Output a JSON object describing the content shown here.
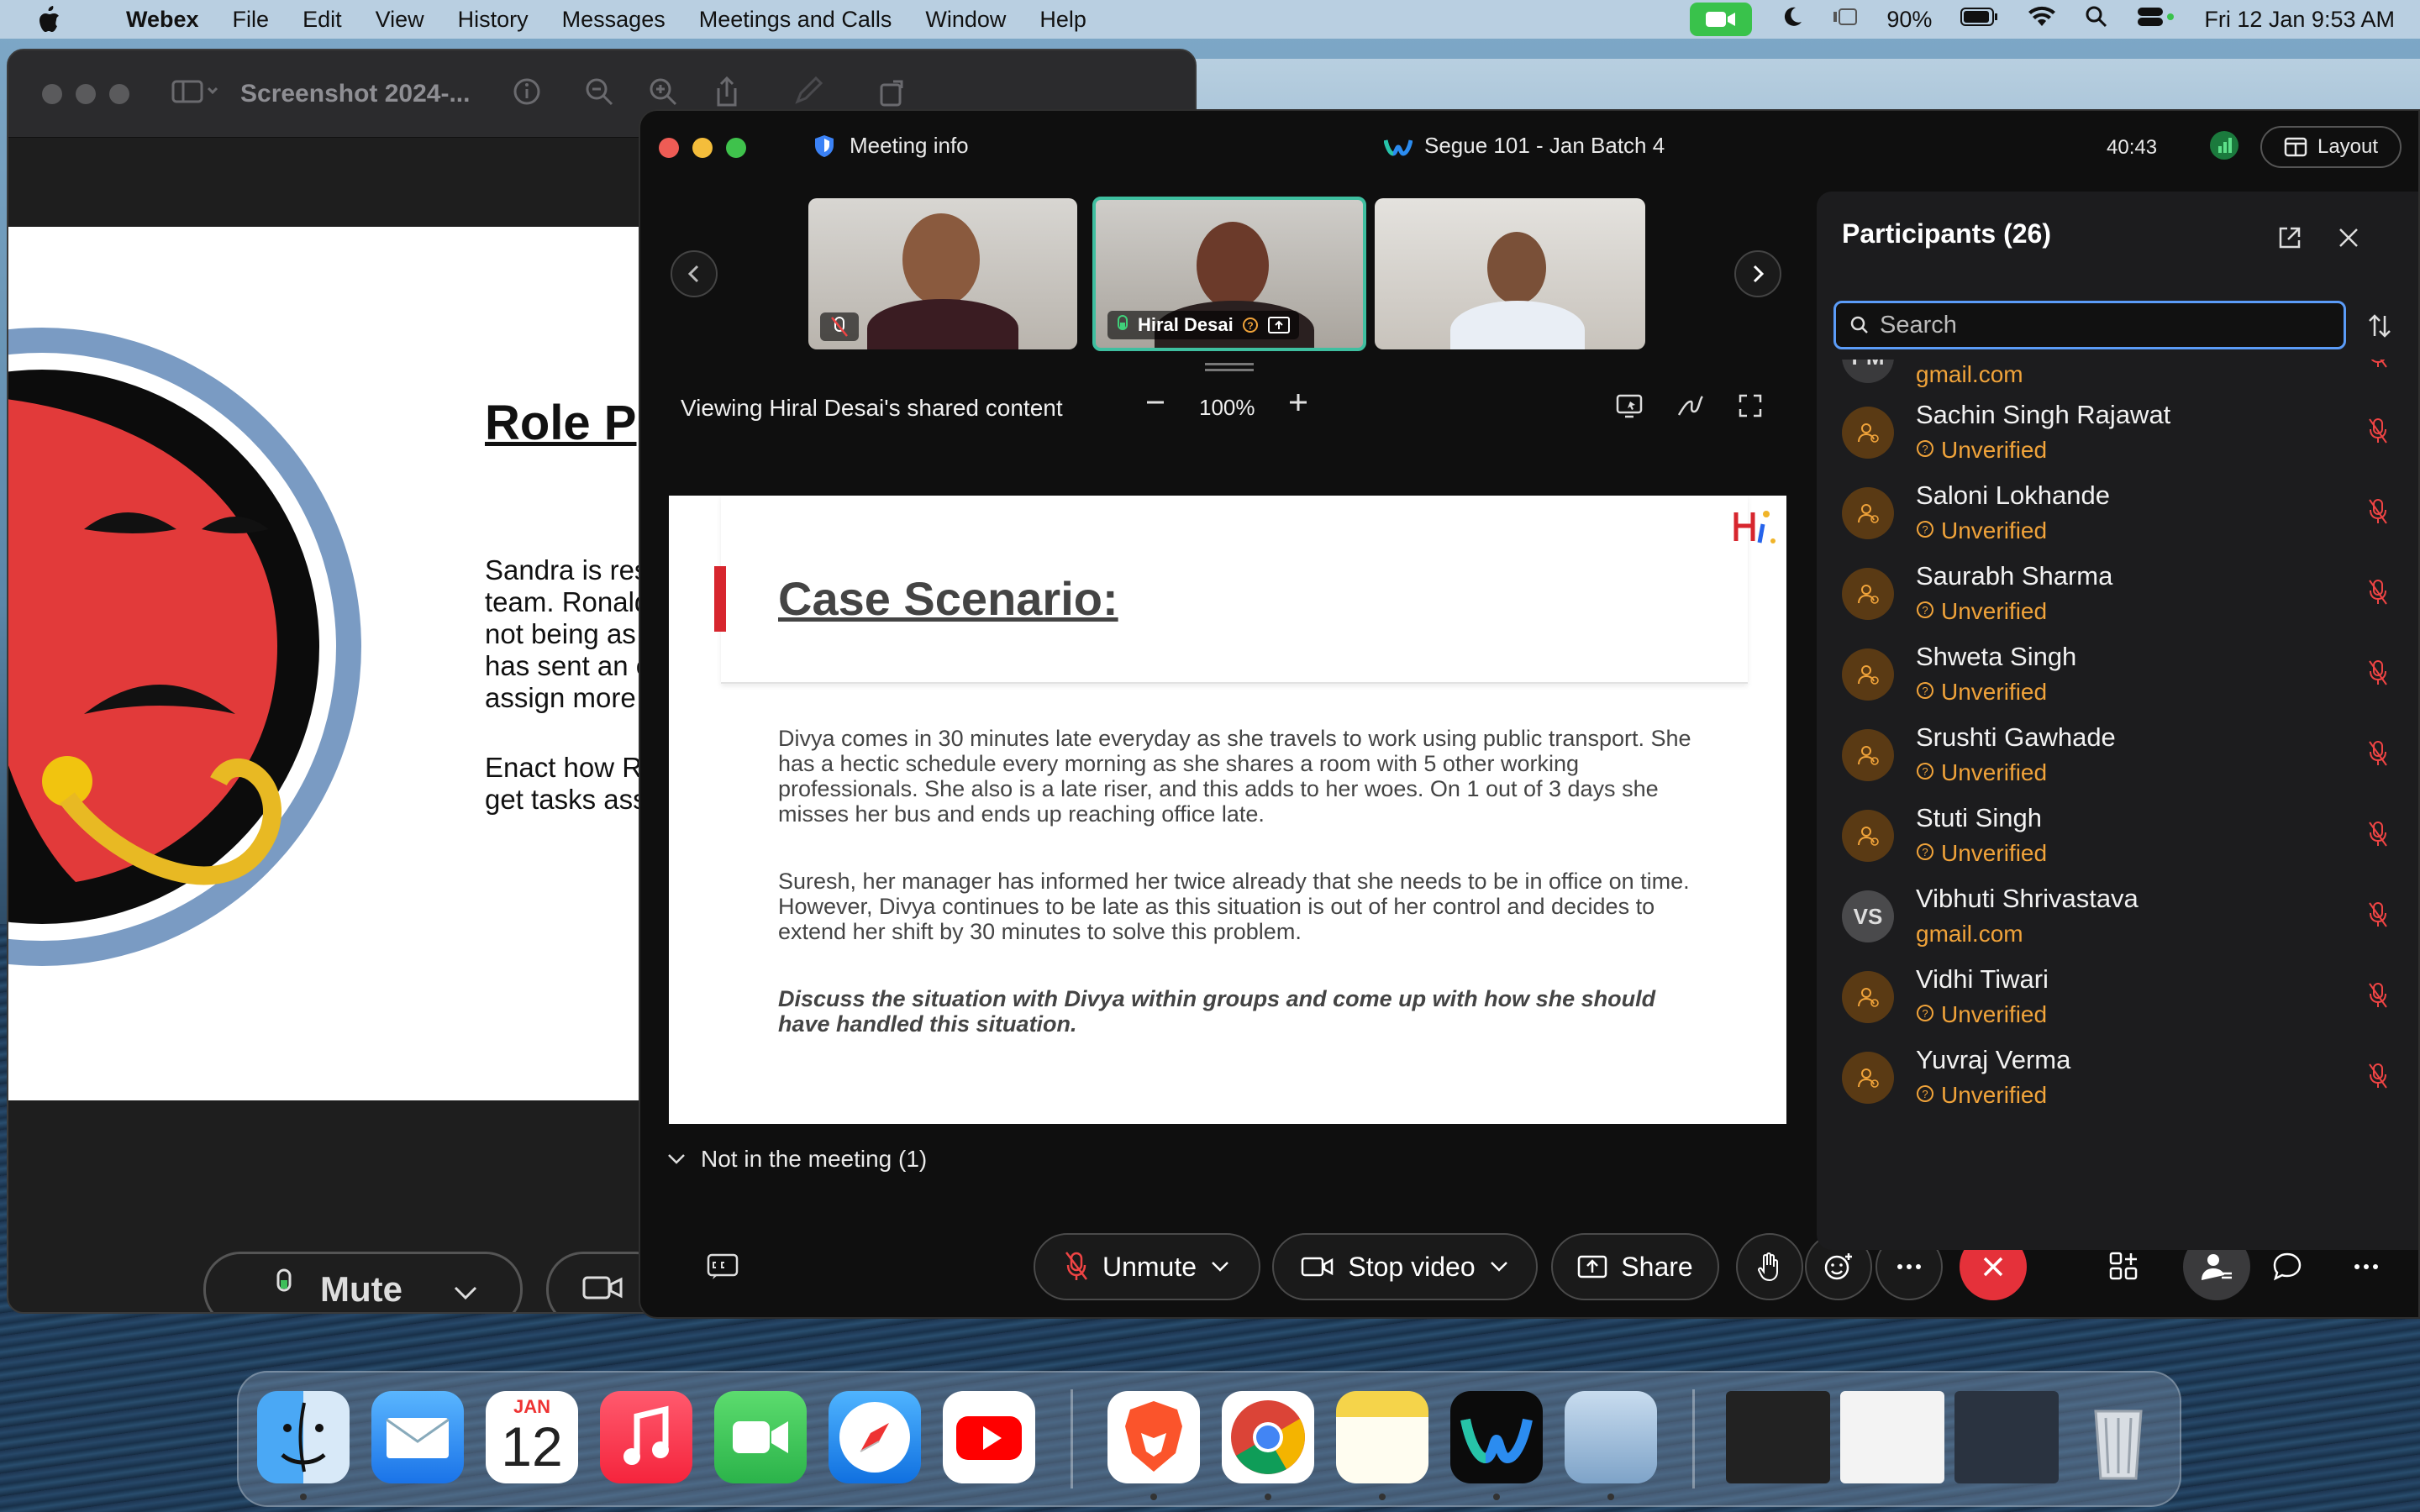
{
  "menubar": {
    "app_name": "Webex",
    "items": [
      "File",
      "Edit",
      "View",
      "History",
      "Messages",
      "Meetings and Calls",
      "Window",
      "Help"
    ],
    "battery": "90%",
    "datetime": "Fri 12 Jan  9:53 AM"
  },
  "preview_window": {
    "title": "Screenshot 2024-...",
    "slide_heading": "Role P",
    "slide_text_lines": [
      "Sandra is res",
      "team. Ronald",
      "not being as",
      "has sent an e",
      "assign more"
    ],
    "slide_text2_lines": [
      "Enact how R",
      "get tasks ass"
    ],
    "mute_label": "Mute"
  },
  "webex": {
    "meeting_info_label": "Meeting info",
    "meeting_title": "Segue 101 - Jan Batch 4",
    "timer": "40:43",
    "layout_label": "Layout",
    "active_speaker_name": "Hiral Desai",
    "share_label": "Viewing Hiral Desai's shared content",
    "zoom_level": "100%",
    "slide": {
      "title": "Case Scenario:",
      "paragraph1": "Divya comes in 30 minutes late everyday as she travels to work using public transport. She has a hectic schedule every morning as she shares a room with 5 other working professionals. She also is a late riser, and this adds to her woes. On 1 out of 3 days she misses her bus and ends up reaching office late.",
      "paragraph2": "Suresh, her manager has informed her twice already that she needs to be in office on time. However, Divya continues to be late as this situation is out of her control and decides to extend her shift by 30 minutes to solve this problem.",
      "paragraph3": "Discuss the situation with Divya within groups and come up with how she should have handled this situation."
    },
    "controls": {
      "unmute": "Unmute",
      "stop_video": "Stop video",
      "share": "Share"
    },
    "participants": {
      "title": "Participants (26)",
      "search_placeholder": "Search",
      "partial_row": {
        "initials": "PM",
        "sub": "gmail.com"
      },
      "rows": [
        {
          "name": "Sachin Singh Rajawat",
          "sub": "Unverified",
          "initials": ""
        },
        {
          "name": "Saloni Lokhande",
          "sub": "Unverified",
          "initials": ""
        },
        {
          "name": "Saurabh Sharma",
          "sub": "Unverified",
          "initials": ""
        },
        {
          "name": "Shweta Singh",
          "sub": "Unverified",
          "initials": ""
        },
        {
          "name": "Srushti Gawhade",
          "sub": "Unverified",
          "initials": ""
        },
        {
          "name": "Stuti Singh",
          "sub": "Unverified",
          "initials": ""
        },
        {
          "name": "Vibhuti Shrivastava",
          "sub": "gmail.com",
          "initials": "VS"
        },
        {
          "name": "Vidhi Tiwari",
          "sub": "Unverified",
          "initials": ""
        },
        {
          "name": "Yuvraj Verma",
          "sub": "Unverified",
          "initials": ""
        }
      ],
      "not_in_meeting": "Not in the meeting (1)"
    }
  },
  "dock": {
    "calendar_month": "JAN",
    "calendar_day": "12"
  },
  "colors": {
    "accent_blue": "#5b9cf8",
    "end_red": "#e5313a",
    "unverified_orange": "#f0a33a",
    "slide_red": "#d7262e"
  }
}
